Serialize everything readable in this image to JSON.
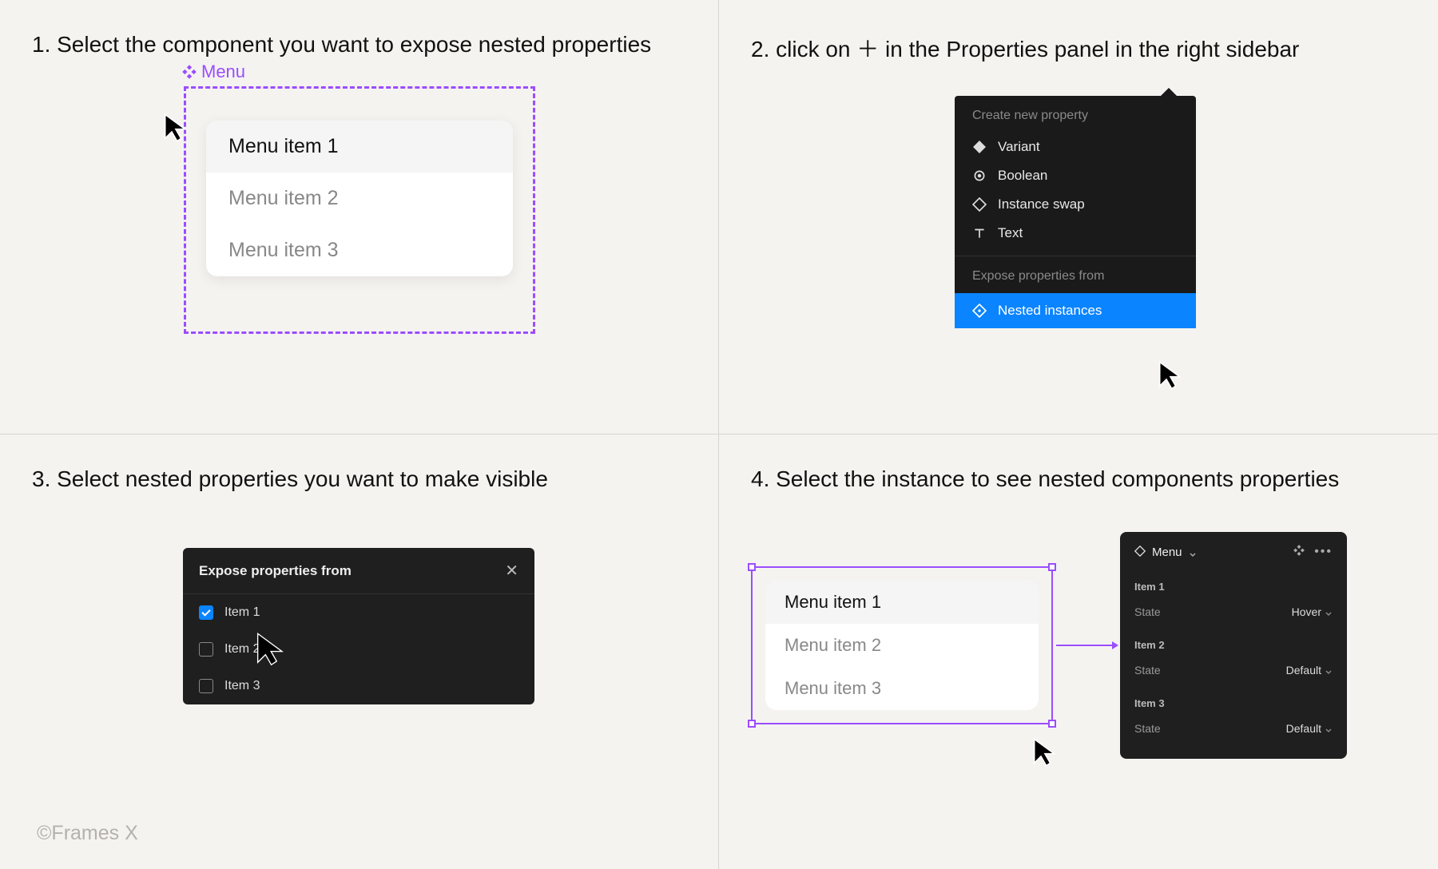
{
  "steps": {
    "s1": {
      "title": "1. Select the component you want to expose nested properties",
      "frame_label": "Menu",
      "menu_items": [
        "Menu item 1",
        "Menu item 2",
        "Menu item 3"
      ]
    },
    "s2": {
      "title": "2. click on ＋ in the Properties panel in the right sidebar",
      "create_header": "Create new property",
      "options": {
        "variant": "Variant",
        "boolean": "Boolean",
        "instance_swap": "Instance swap",
        "text": "Text"
      },
      "expose_header": "Expose properties from",
      "expose_option": "Nested instances"
    },
    "s3": {
      "title": "3. Select nested properties you want to make visible",
      "panel_title": "Expose properties from",
      "items": [
        "Item 1",
        "Item 2",
        "Item 3"
      ]
    },
    "s4": {
      "title": "4. Select the instance to see nested components properties",
      "menu_items": [
        "Menu item 1",
        "Menu item 2",
        "Menu item 3"
      ],
      "panel": {
        "title": "Menu",
        "sections": [
          {
            "label": "Item 1",
            "prop": "State",
            "value": "Hover"
          },
          {
            "label": "Item 2",
            "prop": "State",
            "value": "Default"
          },
          {
            "label": "Item 3",
            "prop": "State",
            "value": "Default"
          }
        ]
      }
    }
  },
  "watermark": "©Frames X"
}
